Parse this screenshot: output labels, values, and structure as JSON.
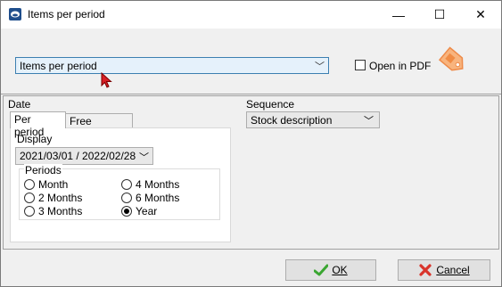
{
  "window": {
    "title": "Items per period",
    "minimize_glyph": "—",
    "maximize_glyph": "☐",
    "close_glyph": "✕"
  },
  "report": {
    "selected": "Items per period",
    "open_in_pdf_label": "Open in PDF",
    "open_in_pdf_checked": false
  },
  "date": {
    "label": "Date",
    "tabs": [
      {
        "label": "Per period",
        "active": true
      },
      {
        "label": "Free selection",
        "active": false
      }
    ],
    "display_label": "Display",
    "display_value": "2021/03/01 / 2022/02/28",
    "periods_label": "Periods",
    "periods": [
      {
        "label": "Month",
        "checked": false
      },
      {
        "label": "2 Months",
        "checked": false
      },
      {
        "label": "3 Months",
        "checked": false
      },
      {
        "label": "4 Months",
        "checked": false
      },
      {
        "label": "6 Months",
        "checked": false
      },
      {
        "label": "Year",
        "checked": true
      }
    ]
  },
  "sequence": {
    "label": "Sequence",
    "value": "Stock description"
  },
  "buttons": {
    "ok": "OK",
    "cancel": "Cancel"
  },
  "colors": {
    "accent_border": "#3c7fb1",
    "selection_bg": "#e5f1fb",
    "ok_icon": "#3aa631",
    "cancel_icon": "#d9342b",
    "tag_icon": "#f5a66b"
  }
}
